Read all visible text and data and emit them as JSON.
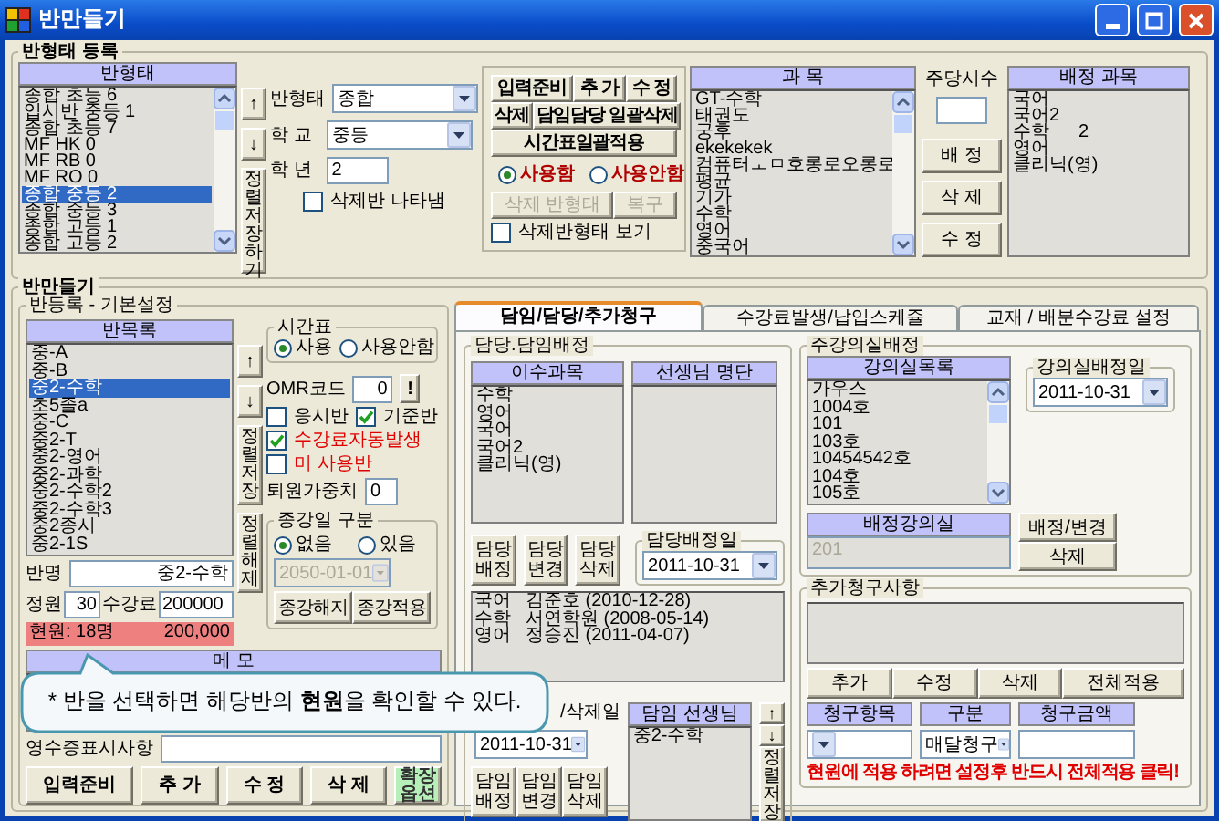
{
  "window": {
    "title": "반만들기"
  },
  "class_type": {
    "title": "반형태 등록",
    "list": {
      "header": "반형태",
      "items": [
        {
          "label": "종합 초등 6",
          "selected": false
        },
        {
          "label": "입시반 중등 1",
          "selected": false
        },
        {
          "label": "종합 초등 7",
          "selected": false
        },
        {
          "label": "MF HK 0",
          "selected": false
        },
        {
          "label": "MF RB 0",
          "selected": false
        },
        {
          "label": "MF RO 0",
          "selected": false
        },
        {
          "label": "종합 중등 2",
          "selected": true
        },
        {
          "label": "종합 중등 3",
          "selected": false
        },
        {
          "label": "종합 고등 1",
          "selected": false
        },
        {
          "label": "종합 고등 2",
          "selected": false
        }
      ]
    },
    "move_buttons": [
      "↑",
      "↓"
    ],
    "sort_button": "정렬저장하기",
    "type_field": {
      "label": "반형태",
      "value": "종합"
    },
    "school_field": {
      "label": "학 교",
      "value": "중등"
    },
    "grade_field": {
      "label": "학 년",
      "value": "2"
    },
    "show_deleted": {
      "label": "삭제반 나타냄",
      "checked": false
    },
    "action_rows": [
      [
        "입력준비",
        "추 가",
        "수 정"
      ],
      [
        "삭제",
        "담임담당 일괄삭제"
      ],
      [
        "시간표일괄적용"
      ]
    ],
    "usage": [
      {
        "label": "사용함",
        "selected": true
      },
      {
        "label": "사용안함",
        "selected": false
      }
    ],
    "restore_buttons": [
      {
        "label": "삭제 반형태",
        "disabled": true
      },
      {
        "label": "복구",
        "disabled": true
      }
    ],
    "show_deleted_types": {
      "label": "삭제반형태 보기",
      "checked": false
    },
    "subjects": {
      "header": "과 목",
      "items": [
        "GT-수학",
        "태권도",
        "궁후",
        "ekekekek",
        "컴퓨터ㅗㅁ호롱로오롱로",
        "평균",
        "기가",
        "수학",
        "영어",
        "중국어"
      ]
    },
    "weekly_hours": {
      "label": "주당시수"
    },
    "subject_buttons": [
      "배 정",
      "삭 제",
      "수 정"
    ],
    "assigned": {
      "header": "배정 과목",
      "items": [
        {
          "name": "국어"
        },
        {
          "name": "국어2"
        },
        {
          "name": "수학",
          "hours": "2"
        },
        {
          "name": "영어"
        },
        {
          "name": "클리닉(영)"
        }
      ]
    }
  },
  "class_section": {
    "title": "반만들기",
    "subtitle": "반등록 - 기본설정",
    "list": {
      "header": "반목록",
      "items": [
        {
          "label": "중-A",
          "selected": false
        },
        {
          "label": "중-B",
          "selected": false
        },
        {
          "label": "중2-수학",
          "selected": true
        },
        {
          "label": "초5졸a",
          "selected": false
        },
        {
          "label": "중-C",
          "selected": false
        },
        {
          "label": "중2-T",
          "selected": false
        },
        {
          "label": "중2-영어",
          "selected": false
        },
        {
          "label": "중2-과학",
          "selected": false
        },
        {
          "label": "중2-수학2",
          "selected": false
        },
        {
          "label": "중2-수학3",
          "selected": false
        },
        {
          "label": "중2종시",
          "selected": false
        },
        {
          "label": "중2-1S",
          "selected": false
        }
      ]
    },
    "move_buttons": [
      "↑",
      "↓"
    ],
    "sort_buttons": [
      "정렬저장",
      "정렬해제"
    ],
    "timetable": {
      "title": "시간표",
      "options": [
        {
          "label": "사용",
          "selected": true
        },
        {
          "label": "사용안함",
          "selected": false
        }
      ]
    },
    "omr": {
      "label": "OMR코드",
      "value": "0",
      "button": "!"
    },
    "flags": [
      {
        "label": "응시반",
        "checked": false,
        "warning": false
      },
      {
        "label": "기준반",
        "checked": true,
        "warning": false
      },
      {
        "label": "수강료자동발생",
        "checked": true,
        "warning": true
      },
      {
        "label": "미 사용반",
        "checked": false,
        "warning": true
      }
    ],
    "withdraw_weight": {
      "label": "퇴원가중치",
      "value": "0"
    },
    "end_date": {
      "title": "종강일 구분",
      "options": [
        {
          "label": "없음",
          "selected": true
        },
        {
          "label": "있음",
          "selected": false
        }
      ],
      "date": {
        "value": "2050-01-01",
        "disabled": true
      },
      "buttons": [
        "종강해지",
        "종강적용"
      ]
    },
    "class_name": {
      "label": "반명",
      "value": "중2-수학"
    },
    "capacity": {
      "label": "정원",
      "value": "30"
    },
    "fee": {
      "label": "수강료",
      "value": "200000"
    },
    "current": {
      "count": "현원: 18명",
      "amount": "200,000"
    },
    "memo": {
      "header": "메 모"
    },
    "receipt": {
      "label": "영수증표시사항"
    },
    "buttons": [
      {
        "label": "입력준비",
        "kind": "normal"
      },
      {
        "label": "추 가",
        "kind": "normal"
      },
      {
        "label": "수 정",
        "kind": "normal"
      },
      {
        "label": "삭 제",
        "kind": "normal"
      },
      {
        "label": "확장옵션",
        "kind": "highlight"
      }
    ]
  },
  "callout": {
    "text": "* 반을 선택하면 해당반의 **현원**을 확인할 수 있다."
  },
  "tabs": [
    {
      "label": "담임/담당/추가청구",
      "selected": true
    },
    {
      "label": "수강료발생/납입스케쥴",
      "selected": false
    },
    {
      "label": "교재 / 배분수강료 설정",
      "selected": false
    }
  ],
  "assignment": {
    "title": "담당.담임배정",
    "subjects": {
      "header": "이수과목",
      "items": [
        "수학",
        "영어",
        "국어",
        "국어2",
        "클리닉(영)"
      ]
    },
    "teachers": {
      "header": "선생님 명단"
    },
    "buttons": [
      "담당 배정",
      "담당 변경",
      "담당 삭제"
    ],
    "date": {
      "title": "담당배정일",
      "value": "2011-10-31"
    },
    "records": [
      {
        "subject": "국어",
        "teacher": "김준호 (2010-12-28)"
      },
      {
        "subject": "수학",
        "teacher": "서연학원 (2008-05-14)"
      },
      {
        "subject": "영어",
        "teacher": "정승진 (2011-04-07)"
      }
    ]
  },
  "homeroom": {
    "date_label": "/삭제일",
    "date": "2011-10-31",
    "header": "담임 선생님",
    "items": [
      "중2-수학"
    ],
    "move_buttons": [
      "↑",
      "↓"
    ],
    "sort_button": "정렬저장",
    "buttons": [
      "담임 배정",
      "담임 변경",
      "담임 삭제"
    ]
  },
  "room": {
    "title": "주강의실배정",
    "list": {
      "header": "강의실목록",
      "items": [
        "가우스",
        "1004호",
        "101",
        "103호",
        "10454542호",
        "104호",
        "105호"
      ]
    },
    "date": {
      "title": "강의실배정일",
      "value": "2011-10-31"
    },
    "assigned": {
      "header": "배정강의실",
      "value": "201",
      "disabled": true
    },
    "buttons": [
      "배정/변경",
      "삭제"
    ]
  },
  "extra_charge": {
    "title": "추가청구사항",
    "buttons": [
      "추가",
      "수정",
      "삭제",
      "전체적용"
    ],
    "columns": [
      "청구항목",
      "구분",
      "청구금액"
    ],
    "type_value": "매달청구",
    "note": "현원에 적용 하려면 설정후 반드시 전체적용 클릭!"
  }
}
